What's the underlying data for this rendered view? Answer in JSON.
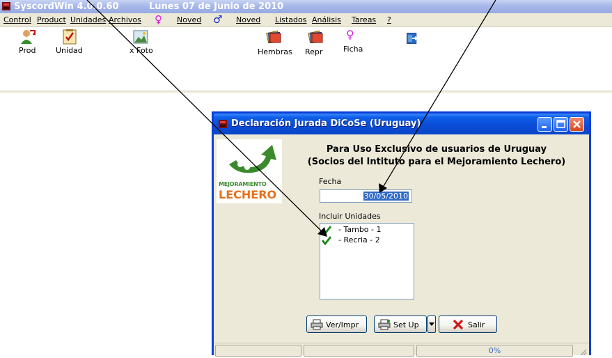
{
  "window": {
    "app_title": "SyscordWin 4.0.0.60",
    "date_title": "Lunes 07 de Junio de 2010",
    "app_icon": "app-icon"
  },
  "menu": {
    "items": [
      {
        "label": "Control"
      },
      {
        "label": "Product"
      },
      {
        "label": "Unidades"
      },
      {
        "label": "Archivos"
      },
      {
        "label": "♀",
        "symbol": true,
        "color": "#d81bd8"
      },
      {
        "label": "Noved"
      },
      {
        "label": "♂",
        "symbol": true,
        "color": "#1628c8"
      },
      {
        "label": "Noved"
      },
      {
        "label": "Listados"
      },
      {
        "label": "Análisis"
      },
      {
        "label": "Tareas"
      },
      {
        "label": "?"
      }
    ]
  },
  "toolbar": {
    "prod": {
      "label": "Prod",
      "icon": "person-icon"
    },
    "unidad": {
      "label": "Unidad",
      "icon": "checklist-icon"
    },
    "foto": {
      "label": "x Foto",
      "icon": "photo-icon"
    },
    "hembras": {
      "label": "Hembras",
      "icon": "cards-icon"
    },
    "repr": {
      "label": "Repr",
      "icon": "cards-icon"
    },
    "ficha": {
      "label": "Ficha",
      "icon": "female-symbol-icon",
      "color": "#d81bd8"
    },
    "extra": {
      "icon": "exit-door-icon"
    }
  },
  "dialog": {
    "title": "Declaración Jurada DiCoSe (Uruguay)",
    "heading1": "Para Uso Exclusivo de usuarios de Uruguay",
    "heading2": "(Socios del Intituto para el Mejoramiento Lechero)",
    "logo": {
      "line1": "MEJORAMIENTO",
      "line2": "LECHERO",
      "green": "#3a8a2c",
      "orange": "#e7701c"
    },
    "fecha_label": "Fecha",
    "fecha_value": "30/05/2010",
    "incluir_label": "Incluir Unidades",
    "unidades": [
      {
        "label": "- Tambo - 1",
        "checked": true
      },
      {
        "label": "- Recria - 2",
        "checked": true
      }
    ],
    "buttons": {
      "ver": "Ver/Impr",
      "setup": "Set Up",
      "salir": "Salir"
    },
    "progress_text": "0%",
    "title_color": "#0a4dd8"
  }
}
